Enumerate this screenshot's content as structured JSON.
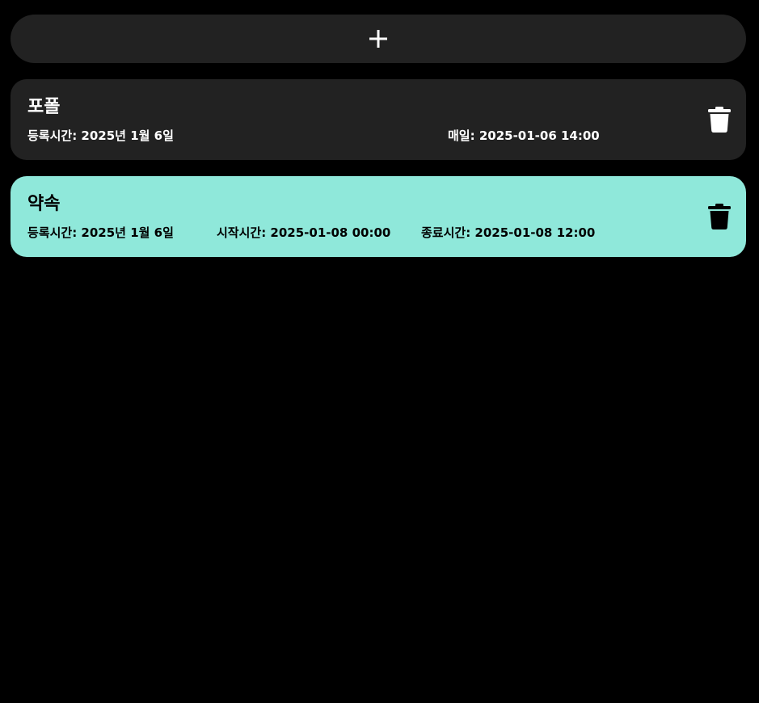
{
  "add_button": {
    "icon": "plus-icon"
  },
  "theme": {
    "card_dark_bg": "#222222",
    "card_light_bg": "#8fe8da",
    "text_light": "#ffffff",
    "text_dark": "#000000"
  },
  "schedules": [
    {
      "title": "포폴",
      "registered": "등록시간: 2025년 1월 6일",
      "daily": "매일: 2025-01-06 14:00",
      "delete_icon": "trash-icon"
    },
    {
      "title": "약속",
      "registered": "등록시간: 2025년 1월 6일",
      "start": "시작시간: 2025-01-08 00:00",
      "end": "종료시간: 2025-01-08 12:00",
      "delete_icon": "trash-icon"
    }
  ]
}
